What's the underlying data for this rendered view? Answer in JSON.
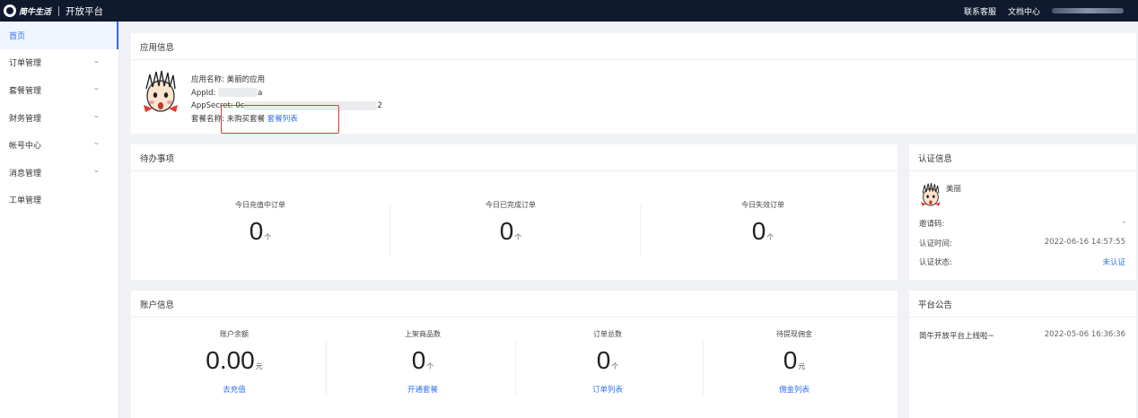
{
  "topbar": {
    "logo_text": "简牛生活",
    "title": "开放平台",
    "links": [
      "联系客服",
      "文档中心"
    ]
  },
  "sidebar": {
    "items": [
      {
        "label": "首页",
        "active": true,
        "expandable": false
      },
      {
        "label": "订单管理",
        "active": false,
        "expandable": true
      },
      {
        "label": "套餐管理",
        "active": false,
        "expandable": true
      },
      {
        "label": "财务管理",
        "active": false,
        "expandable": true
      },
      {
        "label": "帐号中心",
        "active": false,
        "expandable": true
      },
      {
        "label": "消息管理",
        "active": false,
        "expandable": true
      },
      {
        "label": "工单管理",
        "active": false,
        "expandable": false
      }
    ]
  },
  "app_info": {
    "title": "应用信息",
    "name_label": "应用名称:",
    "name_value": "美丽的应用",
    "appid_label": "AppId:",
    "appid_tail": "a",
    "secret_label": "AppSecret:",
    "secret_head": "0c",
    "secret_tail": "2",
    "package_label": "套餐名称:",
    "package_value": "未购买套餐",
    "package_link": "套餐列表"
  },
  "todo": {
    "title": "待办事项",
    "items": [
      {
        "label": "今日充值中订单",
        "value": "0",
        "unit": "个"
      },
      {
        "label": "今日已完成订单",
        "value": "0",
        "unit": "个"
      },
      {
        "label": "今日失效订单",
        "value": "0",
        "unit": "个"
      }
    ]
  },
  "cert": {
    "title": "认证信息",
    "user_name": "美丽",
    "invite_label": "邀请码:",
    "invite_value": "-",
    "time_label": "认证时间:",
    "time_value": "2022-06-16 14:57:55",
    "status_label": "认证状态:",
    "status_value": "未认证"
  },
  "account": {
    "title": "账户信息",
    "items": [
      {
        "label": "账户余额",
        "value": "0.00",
        "unit": "元",
        "link": "去充值"
      },
      {
        "label": "上架商品数",
        "value": "0",
        "unit": "个",
        "link": "开通套餐"
      },
      {
        "label": "订单总数",
        "value": "0",
        "unit": "个",
        "link": "订单列表"
      },
      {
        "label": "待提现佣金",
        "value": "0",
        "unit": "元",
        "link": "佣金列表"
      }
    ]
  },
  "notice": {
    "title": "平台公告",
    "items": [
      {
        "text": "简牛开放平台上线啦~",
        "date": "2022-05-06 16:36:36"
      }
    ]
  },
  "colors": {
    "accent": "#2f6ff0",
    "topbar": "#0f1a2e",
    "highlight": "#e53935"
  }
}
